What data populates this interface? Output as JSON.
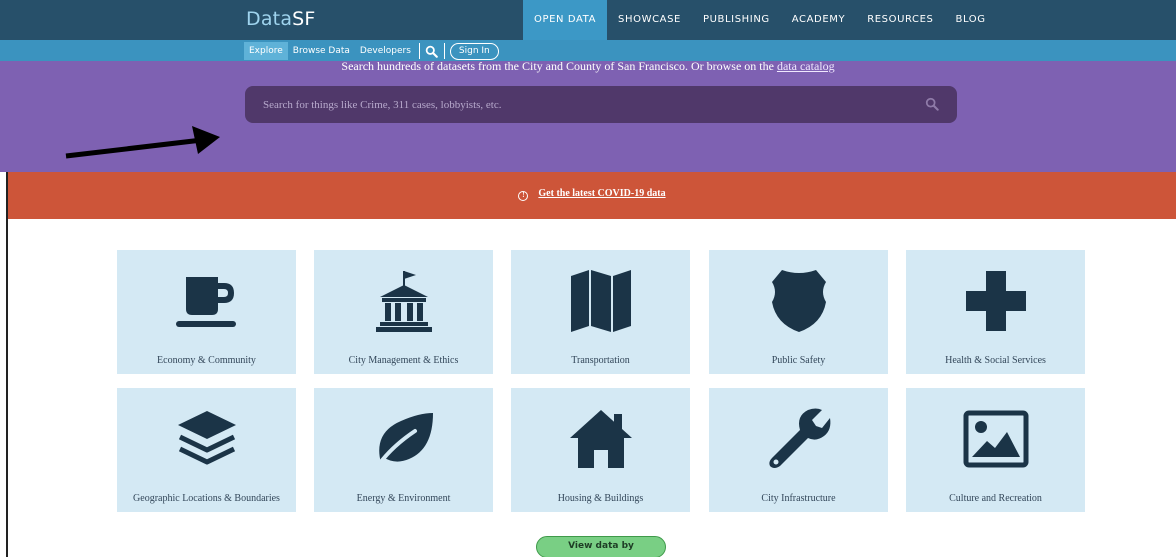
{
  "brand": {
    "prefix": "Data",
    "suffix": "SF"
  },
  "topnav": [
    {
      "label": "OPEN DATA",
      "active": true
    },
    {
      "label": "SHOWCASE",
      "active": false
    },
    {
      "label": "PUBLISHING",
      "active": false
    },
    {
      "label": "ACADEMY",
      "active": false
    },
    {
      "label": "RESOURCES",
      "active": false
    },
    {
      "label": "BLOG",
      "active": false
    }
  ],
  "subnav": {
    "items": [
      {
        "label": "Explore",
        "active": true
      },
      {
        "label": "Browse Data",
        "active": false
      },
      {
        "label": "Developers",
        "active": false
      }
    ],
    "sign_in": "Sign In"
  },
  "hero": {
    "text": "Search hundreds of datasets from the City and County of San Francisco. Or browse on the",
    "link": "data catalog",
    "search_placeholder": "Search for things like Crime, 311 cases, lobbyists, etc."
  },
  "covid": {
    "link": "Get the latest COVID-19 data"
  },
  "categories": [
    {
      "label": "Economy & Community",
      "icon": "coffee-cup-icon"
    },
    {
      "label": "City Management & Ethics",
      "icon": "city-hall-icon"
    },
    {
      "label": "Transportation",
      "icon": "map-icon"
    },
    {
      "label": "Public Safety",
      "icon": "shield-icon"
    },
    {
      "label": "Health & Social Services",
      "icon": "cross-icon"
    },
    {
      "label": "Geographic Locations & Boundaries",
      "icon": "layers-icon"
    },
    {
      "label": "Energy & Environment",
      "icon": "leaf-icon"
    },
    {
      "label": "Housing & Buildings",
      "icon": "house-icon"
    },
    {
      "label": "City Infrastructure",
      "icon": "wrench-icon"
    },
    {
      "label": "Culture and Recreation",
      "icon": "picture-icon"
    }
  ],
  "department_button": "View data by department",
  "colors": {
    "topbar": "#27506a",
    "subbar": "#3b93bf",
    "hero": "#7e61b2",
    "covid": "#cd5539",
    "tile": "#d4e9f4",
    "icon": "#1b3447"
  }
}
